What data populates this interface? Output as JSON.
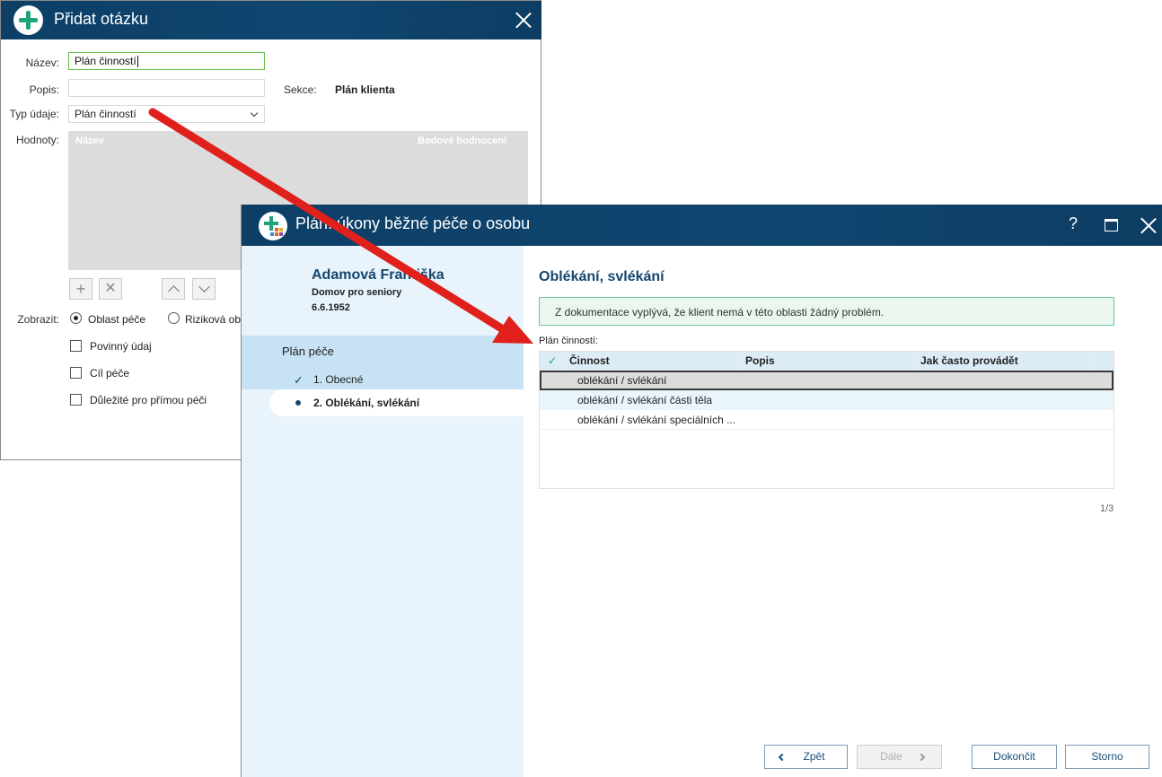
{
  "dialog1": {
    "title": "Přidat otázku",
    "labels": {
      "name": "Název:",
      "description": "Popis:",
      "data_type": "Typ údaje:",
      "values": "Hodnoty:",
      "section": "Sekce:",
      "display": "Zobrazit:"
    },
    "name_value": "Plán činností",
    "description_value": "",
    "section_value": "Plán klienta",
    "data_type_value": "Plán činností",
    "values_grid": {
      "columns": [
        "Název",
        "Bodové hodnocení"
      ]
    },
    "display_options": [
      {
        "label": "Oblast péče",
        "selected": true
      },
      {
        "label": "Riziková obl",
        "selected": false
      }
    ],
    "checkboxes": [
      {
        "label": "Povinný údaj",
        "checked": false
      },
      {
        "label": "Cíl péče",
        "checked": false
      },
      {
        "label": "Důležité pro přímou péči",
        "checked": false
      }
    ]
  },
  "dialog2": {
    "title": "Plán: úkony běžné péče o osobu",
    "client": {
      "name": "Adamová Františka",
      "facility": "Domov pro seniory",
      "birth_date": "6.6.1952"
    },
    "plan_header": "Plán péče",
    "steps": [
      {
        "label": "1. Obecné",
        "state": "done"
      },
      {
        "label": "2. Oblékání, svlékání",
        "state": "current"
      }
    ],
    "section_title": "Oblékání, svlékání",
    "info_message": "Z dokumentace vyplývá, že klient nemá v této oblasti žádný problém.",
    "table_label": "Plán činností:",
    "table": {
      "columns": [
        "Činnost",
        "Popis",
        "Jak často provádět"
      ],
      "rows": [
        {
          "activity": "oblékání / svlékání",
          "description": "",
          "frequency": "",
          "selected": true
        },
        {
          "activity": "oblékání / svlékání části těla",
          "description": "",
          "frequency": "",
          "selected": false
        },
        {
          "activity": "oblékání / svlékání speciálních ...",
          "description": "",
          "frequency": "",
          "selected": false
        }
      ]
    },
    "pager": "1/3",
    "buttons": {
      "back": "Zpět",
      "next": "Dále",
      "finish": "Dokončit",
      "cancel": "Storno"
    },
    "title_icons": [
      "help-icon",
      "maximize-icon",
      "close-icon"
    ]
  },
  "colors": {
    "titlebar": "#0f4670",
    "accent_green": "#1fa37a",
    "arrow": "#e0201b",
    "sidebar": "#e8f3fb"
  }
}
